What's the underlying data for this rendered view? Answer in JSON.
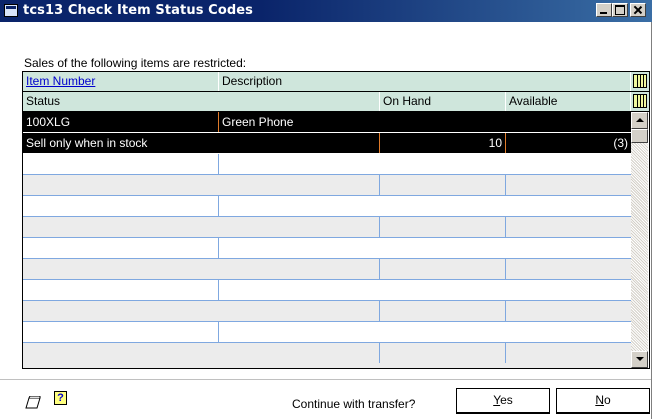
{
  "window": {
    "title": "tcs13 Check Item Status Codes"
  },
  "caption": "Sales of the following items are restricted:",
  "grid": {
    "header1": {
      "item_number": "Item Number",
      "description": "Description"
    },
    "header2": {
      "status": "Status",
      "on_hand": "On Hand",
      "available": "Available"
    },
    "selected_item": {
      "item_number": "100XLG",
      "description": "Green Phone"
    },
    "selected_status": {
      "status": "Sell only when in stock",
      "on_hand": "10",
      "available": "(3)"
    }
  },
  "footer": {
    "prompt": "Continue with transfer?",
    "yes_hotkey": "Y",
    "yes_rest": "es",
    "no_hotkey": "N",
    "no_rest": "o"
  },
  "colors": {
    "title_bar": "#0a246a",
    "header_bg": "#cfe6dc",
    "row_border": "#7fa8e0",
    "link": "#0000cc"
  }
}
